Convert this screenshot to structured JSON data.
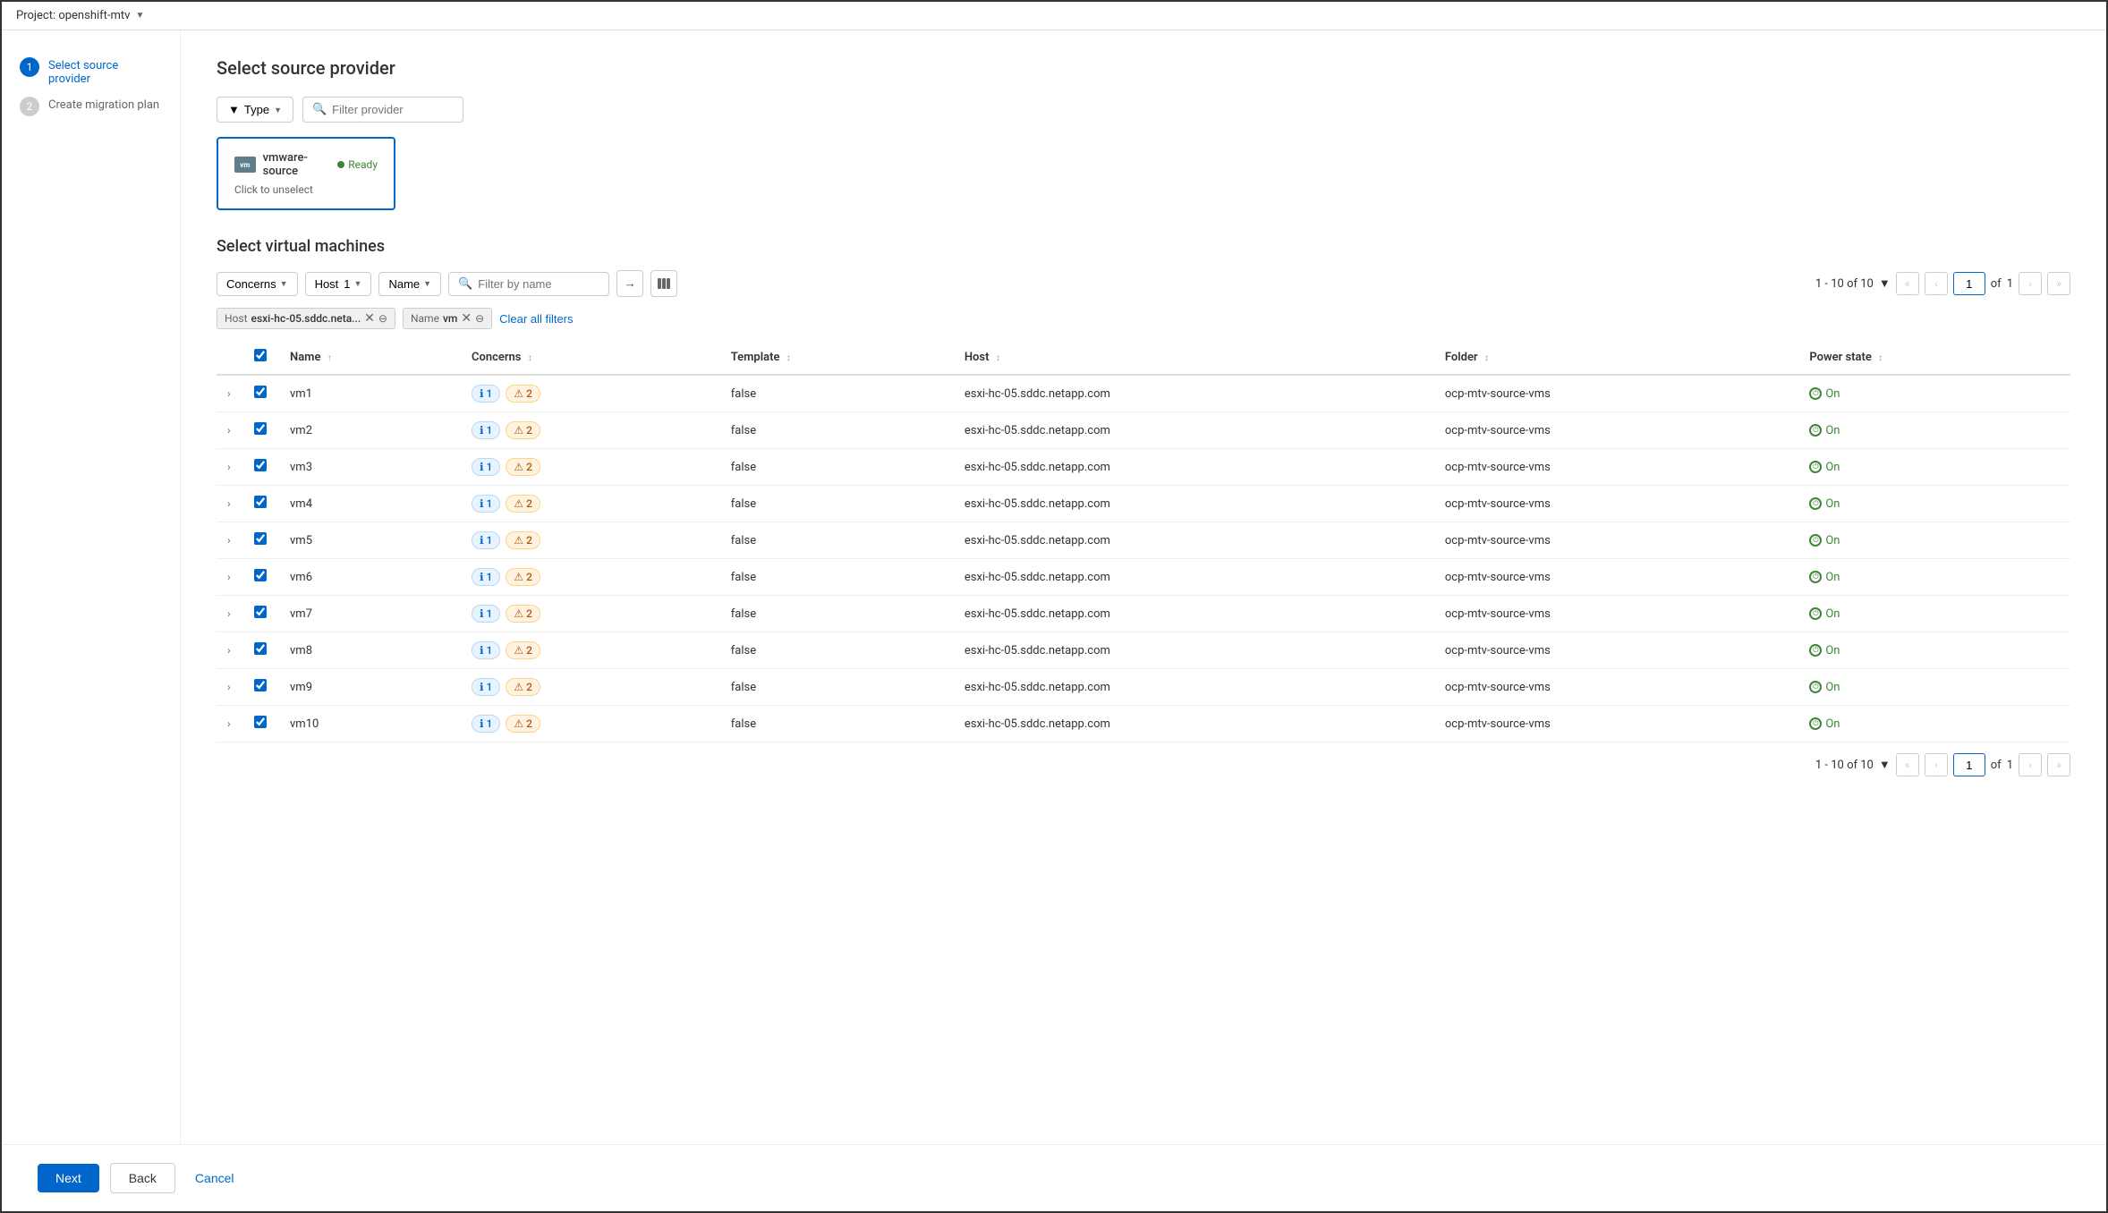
{
  "topBar": {
    "projectLabel": "Project: openshift-mtv",
    "dropdownArrow": "▼"
  },
  "sidebar": {
    "steps": [
      {
        "number": "1",
        "label": "Select source provider",
        "active": true
      },
      {
        "number": "2",
        "label": "Create migration plan",
        "active": false
      }
    ]
  },
  "sourceProvider": {
    "title": "Select source provider",
    "typeFilter": "Type",
    "filterPlaceholder": "Filter provider",
    "provider": {
      "logo": "vm",
      "name": "vmware-source",
      "status": "Ready",
      "clickToUnselect": "Click to unselect"
    }
  },
  "virtualMachines": {
    "title": "Select virtual machines",
    "filters": {
      "concerns": "Concerns",
      "host": "Host",
      "hostValue": "1",
      "name": "Name",
      "searchPlaceholder": "Filter by name"
    },
    "activeFilters": [
      {
        "label": "Host",
        "value": "esxi-hc-05.sddc.neta..."
      },
      {
        "label": "Name",
        "value": "vm"
      }
    ],
    "clearAllLabel": "Clear all filters",
    "pagination": {
      "range": "1 - 10 of 10",
      "page": "1",
      "totalPages": "1"
    },
    "columns": [
      {
        "key": "name",
        "label": "Name",
        "sortable": true
      },
      {
        "key": "concerns",
        "label": "Concerns",
        "sortable": true
      },
      {
        "key": "template",
        "label": "Template",
        "sortable": true
      },
      {
        "key": "host",
        "label": "Host",
        "sortable": true
      },
      {
        "key": "folder",
        "label": "Folder",
        "sortable": true
      },
      {
        "key": "powerState",
        "label": "Power state",
        "sortable": true
      }
    ],
    "rows": [
      {
        "name": "vm1",
        "infoCount": "1",
        "warnCount": "2",
        "template": "false",
        "host": "esxi-hc-05.sddc.netapp.com",
        "folder": "ocp-mtv-source-vms",
        "powerState": "On",
        "checked": true
      },
      {
        "name": "vm2",
        "infoCount": "1",
        "warnCount": "2",
        "template": "false",
        "host": "esxi-hc-05.sddc.netapp.com",
        "folder": "ocp-mtv-source-vms",
        "powerState": "On",
        "checked": true
      },
      {
        "name": "vm3",
        "infoCount": "1",
        "warnCount": "2",
        "template": "false",
        "host": "esxi-hc-05.sddc.netapp.com",
        "folder": "ocp-mtv-source-vms",
        "powerState": "On",
        "checked": true
      },
      {
        "name": "vm4",
        "infoCount": "1",
        "warnCount": "2",
        "template": "false",
        "host": "esxi-hc-05.sddc.netapp.com",
        "folder": "ocp-mtv-source-vms",
        "powerState": "On",
        "checked": true
      },
      {
        "name": "vm5",
        "infoCount": "1",
        "warnCount": "2",
        "template": "false",
        "host": "esxi-hc-05.sddc.netapp.com",
        "folder": "ocp-mtv-source-vms",
        "powerState": "On",
        "checked": true
      },
      {
        "name": "vm6",
        "infoCount": "1",
        "warnCount": "2",
        "template": "false",
        "host": "esxi-hc-05.sddc.netapp.com",
        "folder": "ocp-mtv-source-vms",
        "powerState": "On",
        "checked": true
      },
      {
        "name": "vm7",
        "infoCount": "1",
        "warnCount": "2",
        "template": "false",
        "host": "esxi-hc-05.sddc.netapp.com",
        "folder": "ocp-mtv-source-vms",
        "powerState": "On",
        "checked": true
      },
      {
        "name": "vm8",
        "infoCount": "1",
        "warnCount": "2",
        "template": "false",
        "host": "esxi-hc-05.sddc.netapp.com",
        "folder": "ocp-mtv-source-vms",
        "powerState": "On",
        "checked": true
      },
      {
        "name": "vm9",
        "infoCount": "1",
        "warnCount": "2",
        "template": "false",
        "host": "esxi-hc-05.sddc.netapp.com",
        "folder": "ocp-mtv-source-vms",
        "powerState": "On",
        "checked": true
      },
      {
        "name": "vm10",
        "infoCount": "1",
        "warnCount": "2",
        "template": "false",
        "host": "esxi-hc-05.sddc.netapp.com",
        "folder": "ocp-mtv-source-vms",
        "powerState": "On",
        "checked": true
      }
    ]
  },
  "footer": {
    "nextLabel": "Next",
    "backLabel": "Back",
    "cancelLabel": "Cancel"
  }
}
